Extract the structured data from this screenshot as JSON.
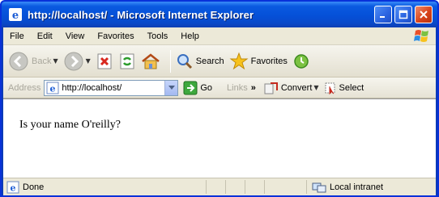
{
  "window": {
    "title": "http://localhost/ - Microsoft Internet Explorer",
    "accent": "#0a5ae0"
  },
  "menu": {
    "items": [
      "File",
      "Edit",
      "View",
      "Favorites",
      "Tools",
      "Help"
    ]
  },
  "toolbar": {
    "back_label": "Back",
    "search_label": "Search",
    "favorites_label": "Favorites"
  },
  "address": {
    "label": "Address",
    "url": "http://localhost/",
    "go_label": "Go",
    "links_label": "Links",
    "convert_label": "Convert",
    "select_label": "Select"
  },
  "content": {
    "text": "Is your name O'reilly?"
  },
  "status": {
    "left_text": "Done",
    "zone_text": "Local intranet"
  }
}
